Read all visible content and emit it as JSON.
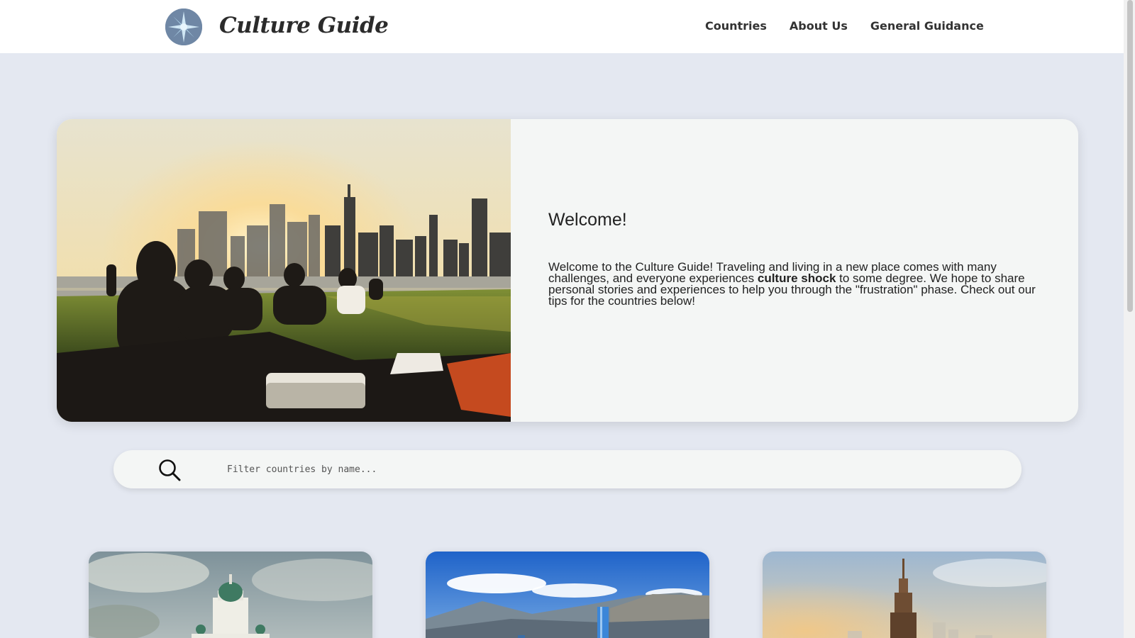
{
  "header": {
    "brand": "Culture Guide",
    "logo_icon": "compass-icon",
    "nav": [
      {
        "label": "Countries"
      },
      {
        "label": "About Us"
      },
      {
        "label": "General Guidance"
      }
    ]
  },
  "hero": {
    "image": "picnic-skyline-photo",
    "title": "Welcome!",
    "body_part1": "Welcome to the Culture Guide! Traveling and living in a new place comes with many challenges, and everyone experiences ",
    "body_bold": "culture shock",
    "body_part2": " to some degree. We hope to share personal stories and experiences to help you through the \"frustration\" phase. Check out our tips for the countries below!"
  },
  "search": {
    "icon": "search-icon",
    "placeholder": "Filter countries by name..."
  },
  "cards": [
    {
      "image": "cathedral-photo"
    },
    {
      "image": "mountain-city-photo"
    },
    {
      "image": "skyscraper-photo"
    }
  ],
  "colors": {
    "page_bg": "#e4e8f1",
    "header_bg": "#ffffff",
    "panel_bg": "#f4f6f5",
    "logo_bg": "#6f87a5"
  }
}
